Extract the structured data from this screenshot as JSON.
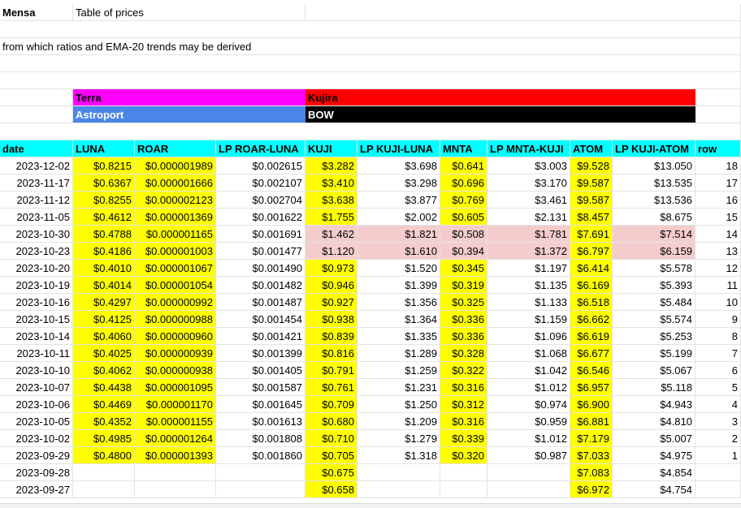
{
  "sheet": {
    "title": {
      "app": "Mensa",
      "subtitle": "Table of prices"
    },
    "note": "from which ratios and EMA-20 trends may be derived",
    "groups": {
      "terra": "Terra",
      "astroport": "Astroport",
      "kujira": "Kujira",
      "bow": "BOW"
    },
    "headers": [
      "date",
      "LUNA",
      "ROAR",
      "LP ROAR-LUNA",
      "KUJI",
      "LP KUJI-LUNA",
      "MNTA",
      "LP MNTA-KUJI",
      "ATOM",
      "LP KUJI-ATOM",
      "row"
    ],
    "rows": [
      [
        "2023-12-02",
        "$0.8215",
        "$0.000001989",
        "$0.002615",
        "$3.282",
        "$3.698",
        "$0.641",
        "$3.003",
        "$9.528",
        "$13.050",
        "18"
      ],
      [
        "2023-11-17",
        "$0.6367",
        "$0.000001666",
        "$0.002107",
        "$3.410",
        "$3.298",
        "$0.696",
        "$3.170",
        "$9.587",
        "$13.535",
        "17"
      ],
      [
        "2023-11-12",
        "$0.8255",
        "$0.000002123",
        "$0.002704",
        "$3.638",
        "$3.877",
        "$0.769",
        "$3.461",
        "$9.587",
        "$13.536",
        "16"
      ],
      [
        "2023-11-05",
        "$0.4612",
        "$0.000001369",
        "$0.001622",
        "$1.755",
        "$2.002",
        "$0.605",
        "$2.131",
        "$8.457",
        "$8.675",
        "15"
      ],
      [
        "2023-10-30",
        "$0.4788",
        "$0.000001165",
        "$0.001691",
        "$1.462",
        "$1.821",
        "$0.508",
        "$1.781",
        "$7.691",
        "$7.514",
        "14"
      ],
      [
        "2023-10-23",
        "$0.4186",
        "$0.000001003",
        "$0.001477",
        "$1.120",
        "$1.610",
        "$0.394",
        "$1.372",
        "$6.797",
        "$6.159",
        "13"
      ],
      [
        "2023-10-20",
        "$0.4010",
        "$0.000001067",
        "$0.001490",
        "$0.973",
        "$1.520",
        "$0.345",
        "$1.197",
        "$6.414",
        "$5.578",
        "12"
      ],
      [
        "2023-10-19",
        "$0.4014",
        "$0.000001054",
        "$0.001482",
        "$0.946",
        "$1.399",
        "$0.319",
        "$1.135",
        "$6.169",
        "$5.393",
        "11"
      ],
      [
        "2023-10-16",
        "$0.4297",
        "$0.000000992",
        "$0.001487",
        "$0.927",
        "$1.356",
        "$0.325",
        "$1.133",
        "$6.518",
        "$5.484",
        "10"
      ],
      [
        "2023-10-15",
        "$0.4125",
        "$0.000000988",
        "$0.001454",
        "$0.938",
        "$1.364",
        "$0.336",
        "$1.159",
        "$6.662",
        "$5.574",
        "9"
      ],
      [
        "2023-10-14",
        "$0.4060",
        "$0.000000960",
        "$0.001421",
        "$0.839",
        "$1.335",
        "$0.336",
        "$1.096",
        "$6.619",
        "$5.253",
        "8"
      ],
      [
        "2023-10-11",
        "$0.4025",
        "$0.000000939",
        "$0.001399",
        "$0.816",
        "$1.289",
        "$0.328",
        "$1.068",
        "$6.677",
        "$5.199",
        "7"
      ],
      [
        "2023-10-10",
        "$0.4062",
        "$0.000000938",
        "$0.001405",
        "$0.791",
        "$1.259",
        "$0.322",
        "$1.042",
        "$6.546",
        "$5.067",
        "6"
      ],
      [
        "2023-10-07",
        "$0.4438",
        "$0.000001095",
        "$0.001587",
        "$0.761",
        "$1.231",
        "$0.316",
        "$1.012",
        "$6.957",
        "$5.118",
        "5"
      ],
      [
        "2023-10-06",
        "$0.4469",
        "$0.000001170",
        "$0.001645",
        "$0.709",
        "$1.250",
        "$0.312",
        "$0.974",
        "$6.900",
        "$4.943",
        "4"
      ],
      [
        "2023-10-05",
        "$0.4352",
        "$0.000001155",
        "$0.001613",
        "$0.680",
        "$1.209",
        "$0.316",
        "$0.959",
        "$6.881",
        "$4.810",
        "3"
      ],
      [
        "2023-10-02",
        "$0.4985",
        "$0.000001264",
        "$0.001808",
        "$0.710",
        "$1.279",
        "$0.339",
        "$1.012",
        "$7.179",
        "$5.007",
        "2"
      ],
      [
        "2023-09-29",
        "$0.4800",
        "$0.000001393",
        "$0.001860",
        "$0.705",
        "$1.318",
        "$0.320",
        "$0.987",
        "$7.033",
        "$4.975",
        "1"
      ],
      [
        "2023-09-28",
        "",
        "",
        "",
        "$0.675",
        "",
        "",
        "",
        "$7.083",
        "$4.854",
        ""
      ],
      [
        "2023-09-27",
        "",
        "",
        "",
        "$0.658",
        "",
        "",
        "",
        "$6.972",
        "$4.754",
        ""
      ]
    ],
    "highlighted_rows": [
      4,
      5
    ]
  },
  "colors": {
    "terra": "#ff00ff",
    "astroport": "#4a86e8",
    "kujira": "#ff0000",
    "bow": "#000000",
    "header": "#00ffff",
    "price_col": "#ffff00",
    "highlight": "#f4cccc"
  }
}
